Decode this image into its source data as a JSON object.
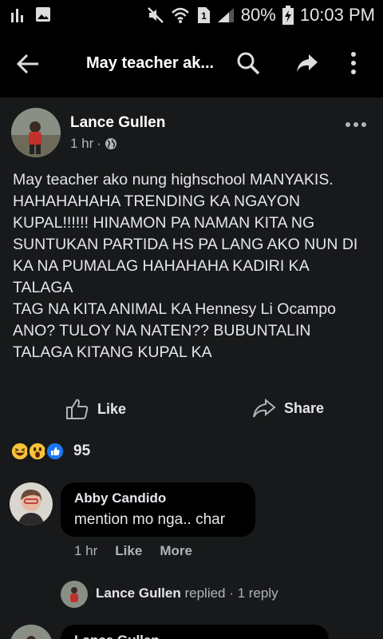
{
  "status_bar": {
    "battery": "80%",
    "time": "10:03 PM"
  },
  "app_bar": {
    "title": "May teacher ak..."
  },
  "post": {
    "author": "Lance Gullen",
    "time": "1 hr",
    "separator": "·",
    "text_lines": [
      "May teacher ako nung highschool MANYAKIS.",
      "HAHAHAHAHA TRENDING KA NGAYON",
      "KUPAL!!!!!! HINAMON PA NAMAN KITA NG",
      "SUNTUKAN PARTIDA HS PA LANG AKO NUN DI",
      "KA NA PUMALAG HAHAHAHA KADIRI KA",
      "TALAGA",
      "TAG NA KITA ANIMAL KA Hennesy Li Ocampo",
      "ANO? TULOY NA NATEN?? BUBUNTALIN",
      "TALAGA KITANG KUPAL KA"
    ],
    "like_label": "Like",
    "share_label": "Share",
    "reaction_count": "95"
  },
  "comment": {
    "author": "Abby Candido",
    "text": "mention mo nga.. char",
    "time": "1 hr",
    "like_label": "Like",
    "more_label": "More"
  },
  "reply_summary": {
    "name": "Lance Gullen",
    "action": " replied · 1 reply"
  },
  "next_comment": {
    "author": "Lance Gullen"
  }
}
